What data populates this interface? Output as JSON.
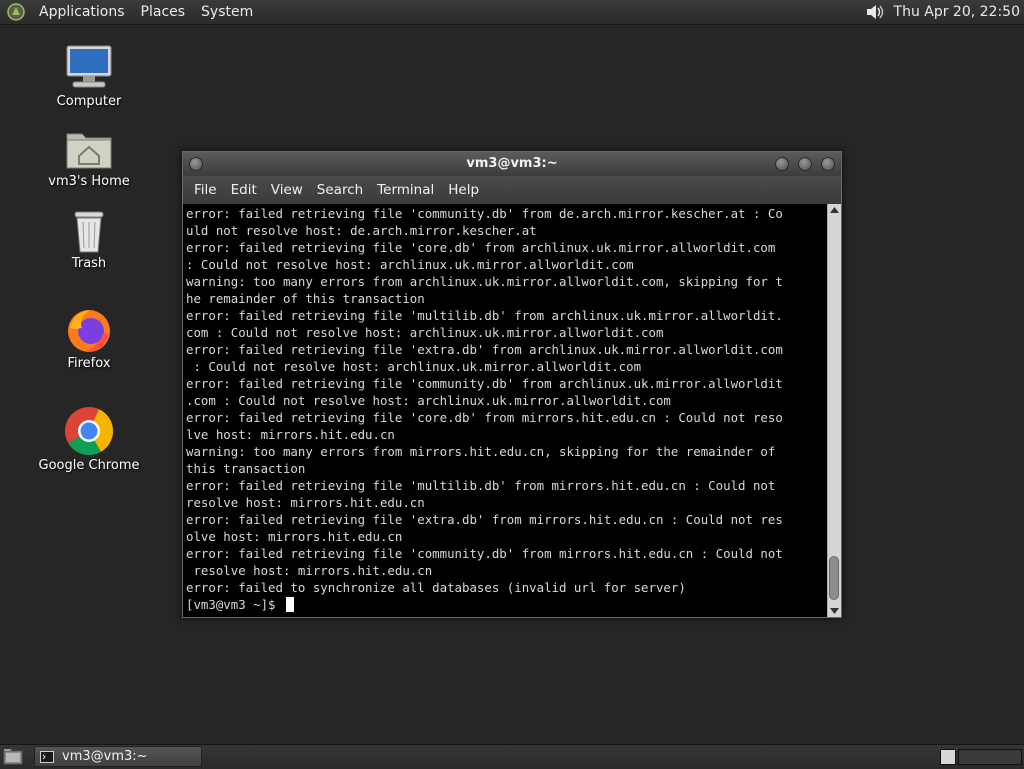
{
  "top_panel": {
    "menus": [
      "Applications",
      "Places",
      "System"
    ],
    "clock": "Thu Apr 20, 22:50",
    "icons": [
      "distro-logo-icon",
      "volume-icon"
    ]
  },
  "desktop": {
    "icons": [
      {
        "label": "Computer",
        "icon": "computer-icon"
      },
      {
        "label": "vm3's Home",
        "icon": "home-folder-icon"
      },
      {
        "label": "Trash",
        "icon": "trash-icon"
      },
      {
        "label": "Firefox",
        "icon": "firefox-icon"
      },
      {
        "label": "Google Chrome",
        "icon": "chrome-icon"
      }
    ]
  },
  "window": {
    "title": "vm3@vm3:~",
    "menu": [
      "File",
      "Edit",
      "View",
      "Search",
      "Terminal",
      "Help"
    ],
    "terminal_lines": [
      "error: failed retrieving file 'community.db' from de.arch.mirror.kescher.at : Co",
      "uld not resolve host: de.arch.mirror.kescher.at",
      "error: failed retrieving file 'core.db' from archlinux.uk.mirror.allworldit.com",
      ": Could not resolve host: archlinux.uk.mirror.allworldit.com",
      "warning: too many errors from archlinux.uk.mirror.allworldit.com, skipping for t",
      "he remainder of this transaction",
      "error: failed retrieving file 'multilib.db' from archlinux.uk.mirror.allworldit.",
      "com : Could not resolve host: archlinux.uk.mirror.allworldit.com",
      "error: failed retrieving file 'extra.db' from archlinux.uk.mirror.allworldit.com",
      " : Could not resolve host: archlinux.uk.mirror.allworldit.com",
      "error: failed retrieving file 'community.db' from archlinux.uk.mirror.allworldit",
      ".com : Could not resolve host: archlinux.uk.mirror.allworldit.com",
      "error: failed retrieving file 'core.db' from mirrors.hit.edu.cn : Could not reso",
      "lve host: mirrors.hit.edu.cn",
      "warning: too many errors from mirrors.hit.edu.cn, skipping for the remainder of",
      "this transaction",
      "error: failed retrieving file 'multilib.db' from mirrors.hit.edu.cn : Could not",
      "resolve host: mirrors.hit.edu.cn",
      "error: failed retrieving file 'extra.db' from mirrors.hit.edu.cn : Could not res",
      "olve host: mirrors.hit.edu.cn",
      "error: failed retrieving file 'community.db' from mirrors.hit.edu.cn : Could not",
      " resolve host: mirrors.hit.edu.cn",
      "error: failed to synchronize all databases (invalid url for server)"
    ],
    "prompt": "[vm3@vm3 ~]$ "
  },
  "taskbar": {
    "task_label": "vm3@vm3:~",
    "icons": [
      "show-desktop-icon",
      "terminal-icon"
    ]
  }
}
